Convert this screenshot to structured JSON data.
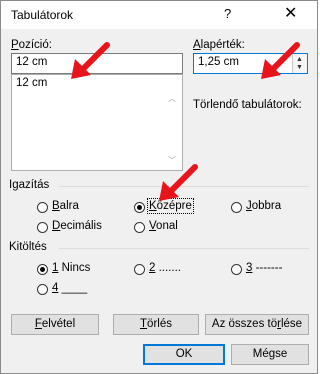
{
  "dialog": {
    "title": "Tabulátorok",
    "help": "?",
    "close": "✕"
  },
  "position": {
    "label_u": "P",
    "label_rest": "ozíció:",
    "value": "12 cm",
    "list_items": [
      "12 cm"
    ]
  },
  "default_tab": {
    "label_u": "A",
    "label_rest": "lapérték:",
    "value": "1,25 cm"
  },
  "clear_label": "Törlendő tabulátorok:",
  "alignment": {
    "heading": "Igazítás",
    "left": {
      "u": "B",
      "rest": "alra"
    },
    "center": {
      "u": "K",
      "rest": "özépre"
    },
    "right": {
      "u": "J",
      "rest": "obbra"
    },
    "decimal": {
      "u": "D",
      "rest": "ecimális"
    },
    "bar": {
      "u": "V",
      "rest": "onal"
    },
    "selected": "center"
  },
  "leader": {
    "heading": "Kitöltés",
    "opt1": {
      "u": "1",
      "rest": " Nincs"
    },
    "opt2": {
      "u": "2",
      "rest": " ......."
    },
    "opt3": {
      "u": "3",
      "rest": " -------"
    },
    "opt4": {
      "u": "4",
      "rest": " ____"
    },
    "selected": "1"
  },
  "buttons": {
    "set": {
      "u": "F",
      "rest": "elvétel"
    },
    "clear": {
      "u": "T",
      "rest": "örlés"
    },
    "clear_all_pre": "Az összes tö",
    "clear_all_u": "r",
    "clear_all_post": "lése",
    "ok": "OK",
    "cancel": "Mégse"
  },
  "annotation_color": "#e8141c"
}
